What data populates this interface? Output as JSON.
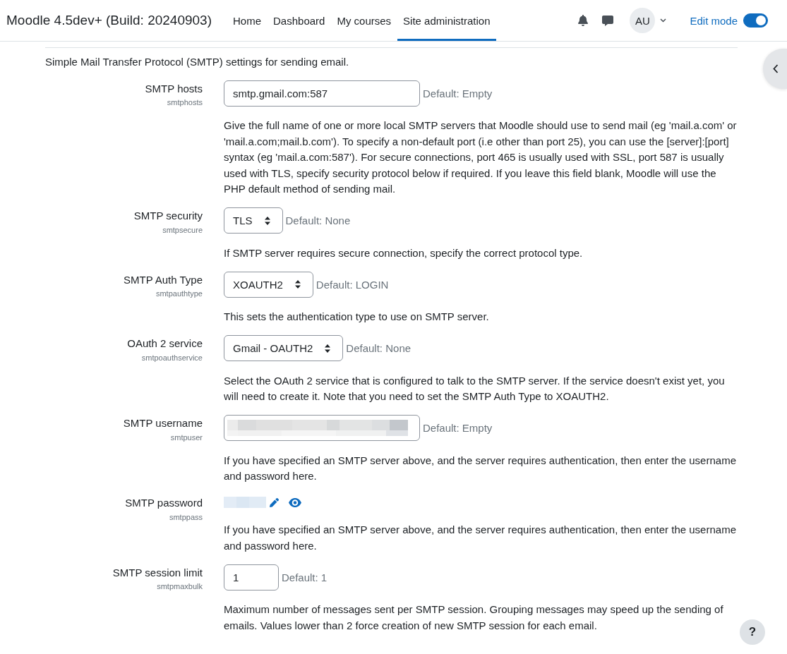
{
  "navbar": {
    "brand": "Moodle 4.5dev+ (Build: 20240903)",
    "nav_items": [
      {
        "label": "Home",
        "selected": false
      },
      {
        "label": "Dashboard",
        "selected": false
      },
      {
        "label": "My courses",
        "selected": false
      },
      {
        "label": "Site administration",
        "selected": true
      }
    ],
    "user_menu": {
      "initials": "AU"
    },
    "edit_mode": {
      "label": "Edit mode",
      "on": true
    }
  },
  "settings": {
    "intro": "Simple Mail Transfer Protocol (SMTP) settings for sending email.",
    "items": [
      {
        "kind": "text",
        "label": "SMTP hosts",
        "key": "smtphosts",
        "value": "smtp.gmail.com:587",
        "default": "Default: Empty",
        "description": "Give the full name of one or more local SMTP servers that Moodle should use to send mail (eg 'mail.a.com' or 'mail.a.com;mail.b.com'). To specify a non-default port (i.e other than port 25), you can use the [server]:[port] syntax (eg 'mail.a.com:587'). For secure connections, port 465 is usually used with SSL, port 587 is usually used with TLS, specify security protocol below if required. If you leave this field blank, Moodle will use the PHP default method of sending mail."
      },
      {
        "kind": "select",
        "label": "SMTP security",
        "key": "smtpsecure",
        "value": "TLS",
        "default": "Default: None",
        "description": "If SMTP server requires secure connection, specify the correct protocol type."
      },
      {
        "kind": "select",
        "label": "SMTP Auth Type",
        "key": "smtpauthtype",
        "value": "XOAUTH2",
        "default": "Default: LOGIN",
        "description": "This sets the authentication type to use on SMTP server."
      },
      {
        "kind": "select",
        "label": "OAuth 2 service",
        "key": "smtpoauthservice",
        "value": "Gmail - OAUTH2",
        "default": "Default: None",
        "description": "Select the OAuth 2 service that is configured to talk to the SMTP server. If the service doesn't exist yet, you will need to create it. Note that you need to set the SMTP Auth Type to XOAUTH2."
      },
      {
        "kind": "blurred_text",
        "label": "SMTP username",
        "key": "smtpuser",
        "default": "Default: Empty",
        "description": "If you have specified an SMTP server above, and the server requires authentication, then enter the username and password here."
      },
      {
        "kind": "password",
        "label": "SMTP password",
        "key": "smtppass",
        "description": "If you have specified an SMTP server above, and the server requires authentication, then enter the username and password here."
      },
      {
        "kind": "short_text",
        "label": "SMTP session limit",
        "key": "smtpmaxbulk",
        "value": "1",
        "default": "Default: 1",
        "description": "Maximum number of messages sent per SMTP session. Grouping messages may speed up the sending of emails. Values lower than 2 force creation of new SMTP session for each email."
      }
    ]
  },
  "help_button": {
    "label": "?"
  }
}
